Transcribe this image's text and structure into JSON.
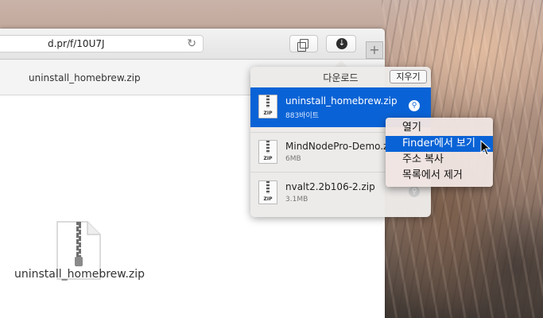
{
  "browser": {
    "url": "d.pr/f/10U7J",
    "tab_title": "uninstall_homebrew.zip",
    "new_tab_label": "+"
  },
  "page": {
    "file_name": "uninstall_homebrew.zip"
  },
  "downloads": {
    "title": "다운로드",
    "clear_label": "지우기",
    "items": [
      {
        "name": "uninstall_homebrew.zip",
        "size": "883바이트",
        "icon": "zip-file-icon",
        "selected": true
      },
      {
        "name": "MindNodePro-Demo.zip",
        "size": "6MB",
        "icon": "zip-file-icon",
        "selected": false
      },
      {
        "name": "nvalt2.2b106-2.zip",
        "size": "3.1MB",
        "icon": "zip-file-icon",
        "selected": false
      }
    ],
    "zip_label": "ZIP"
  },
  "context_menu": {
    "items": [
      {
        "label": "열기"
      },
      {
        "label": "Finder에서 보기",
        "highlighted": true
      },
      {
        "label": "주소 복사"
      },
      {
        "label": "목록에서 제거"
      }
    ]
  },
  "colors": {
    "selection_blue": "#0a63d6",
    "menu_bg": "#f0e4e1",
    "popover_bg": "#eceae8"
  }
}
